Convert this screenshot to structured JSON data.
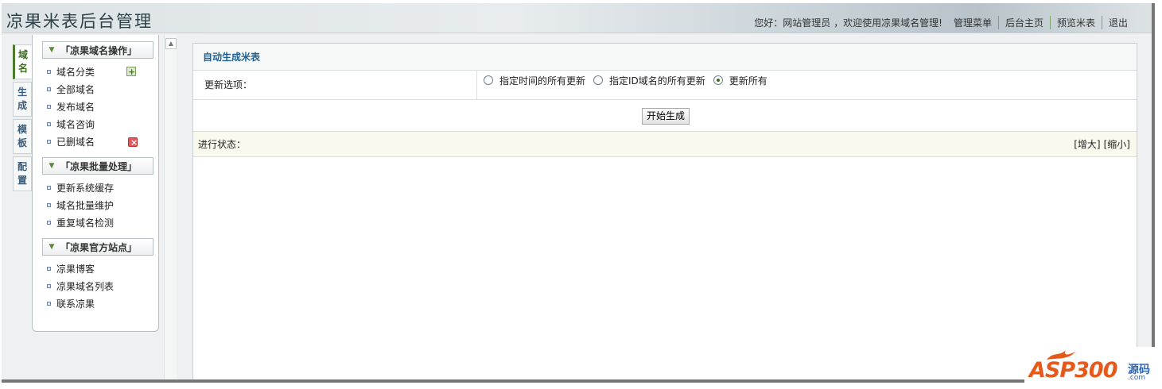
{
  "header": {
    "brand": "凉果米表后台管理",
    "greeting": "您好：网站管理员 ，欢迎使用凉果域名管理!",
    "links": [
      "管理菜单",
      "后台主页",
      "预览米表",
      "退出"
    ]
  },
  "vtabs": [
    {
      "label": "域名",
      "active": true
    },
    {
      "label": "生成",
      "active": false
    },
    {
      "label": "模板",
      "active": false
    },
    {
      "label": "配置",
      "active": false
    }
  ],
  "sidebar": {
    "groups": [
      {
        "title": "「凉果域名操作」",
        "items": [
          "域名分类",
          "全部域名",
          "发布域名",
          "域名咨询",
          "已删域名"
        ]
      },
      {
        "title": "「凉果批量处理」",
        "items": [
          "更新系统缓存",
          "域名批量维护",
          "重复域名检测"
        ]
      },
      {
        "title": "「凉果官方站点」",
        "items": [
          "凉果博客",
          "凉果域名列表",
          "联系凉果"
        ]
      }
    ]
  },
  "main": {
    "title": "自动生成米表",
    "option_label": "更新选项：",
    "radios": [
      {
        "label": "指定时间的所有更新",
        "checked": false
      },
      {
        "label": "指定ID域名的所有更新",
        "checked": false
      },
      {
        "label": "更新所有",
        "checked": true
      }
    ],
    "start_button": "开始生成",
    "status_label": "进行状态：",
    "zoom_in": "[增大]",
    "zoom_out": "[缩小]"
  },
  "watermark": {
    "brand": "ASP300",
    "cn": "源码",
    "url": ".com"
  },
  "colors": {
    "accent_green": "#4b7c2b",
    "title_blue": "#1f5f8f",
    "watermark_orange": "#e55a1b",
    "watermark_blue": "#2b66b8"
  }
}
